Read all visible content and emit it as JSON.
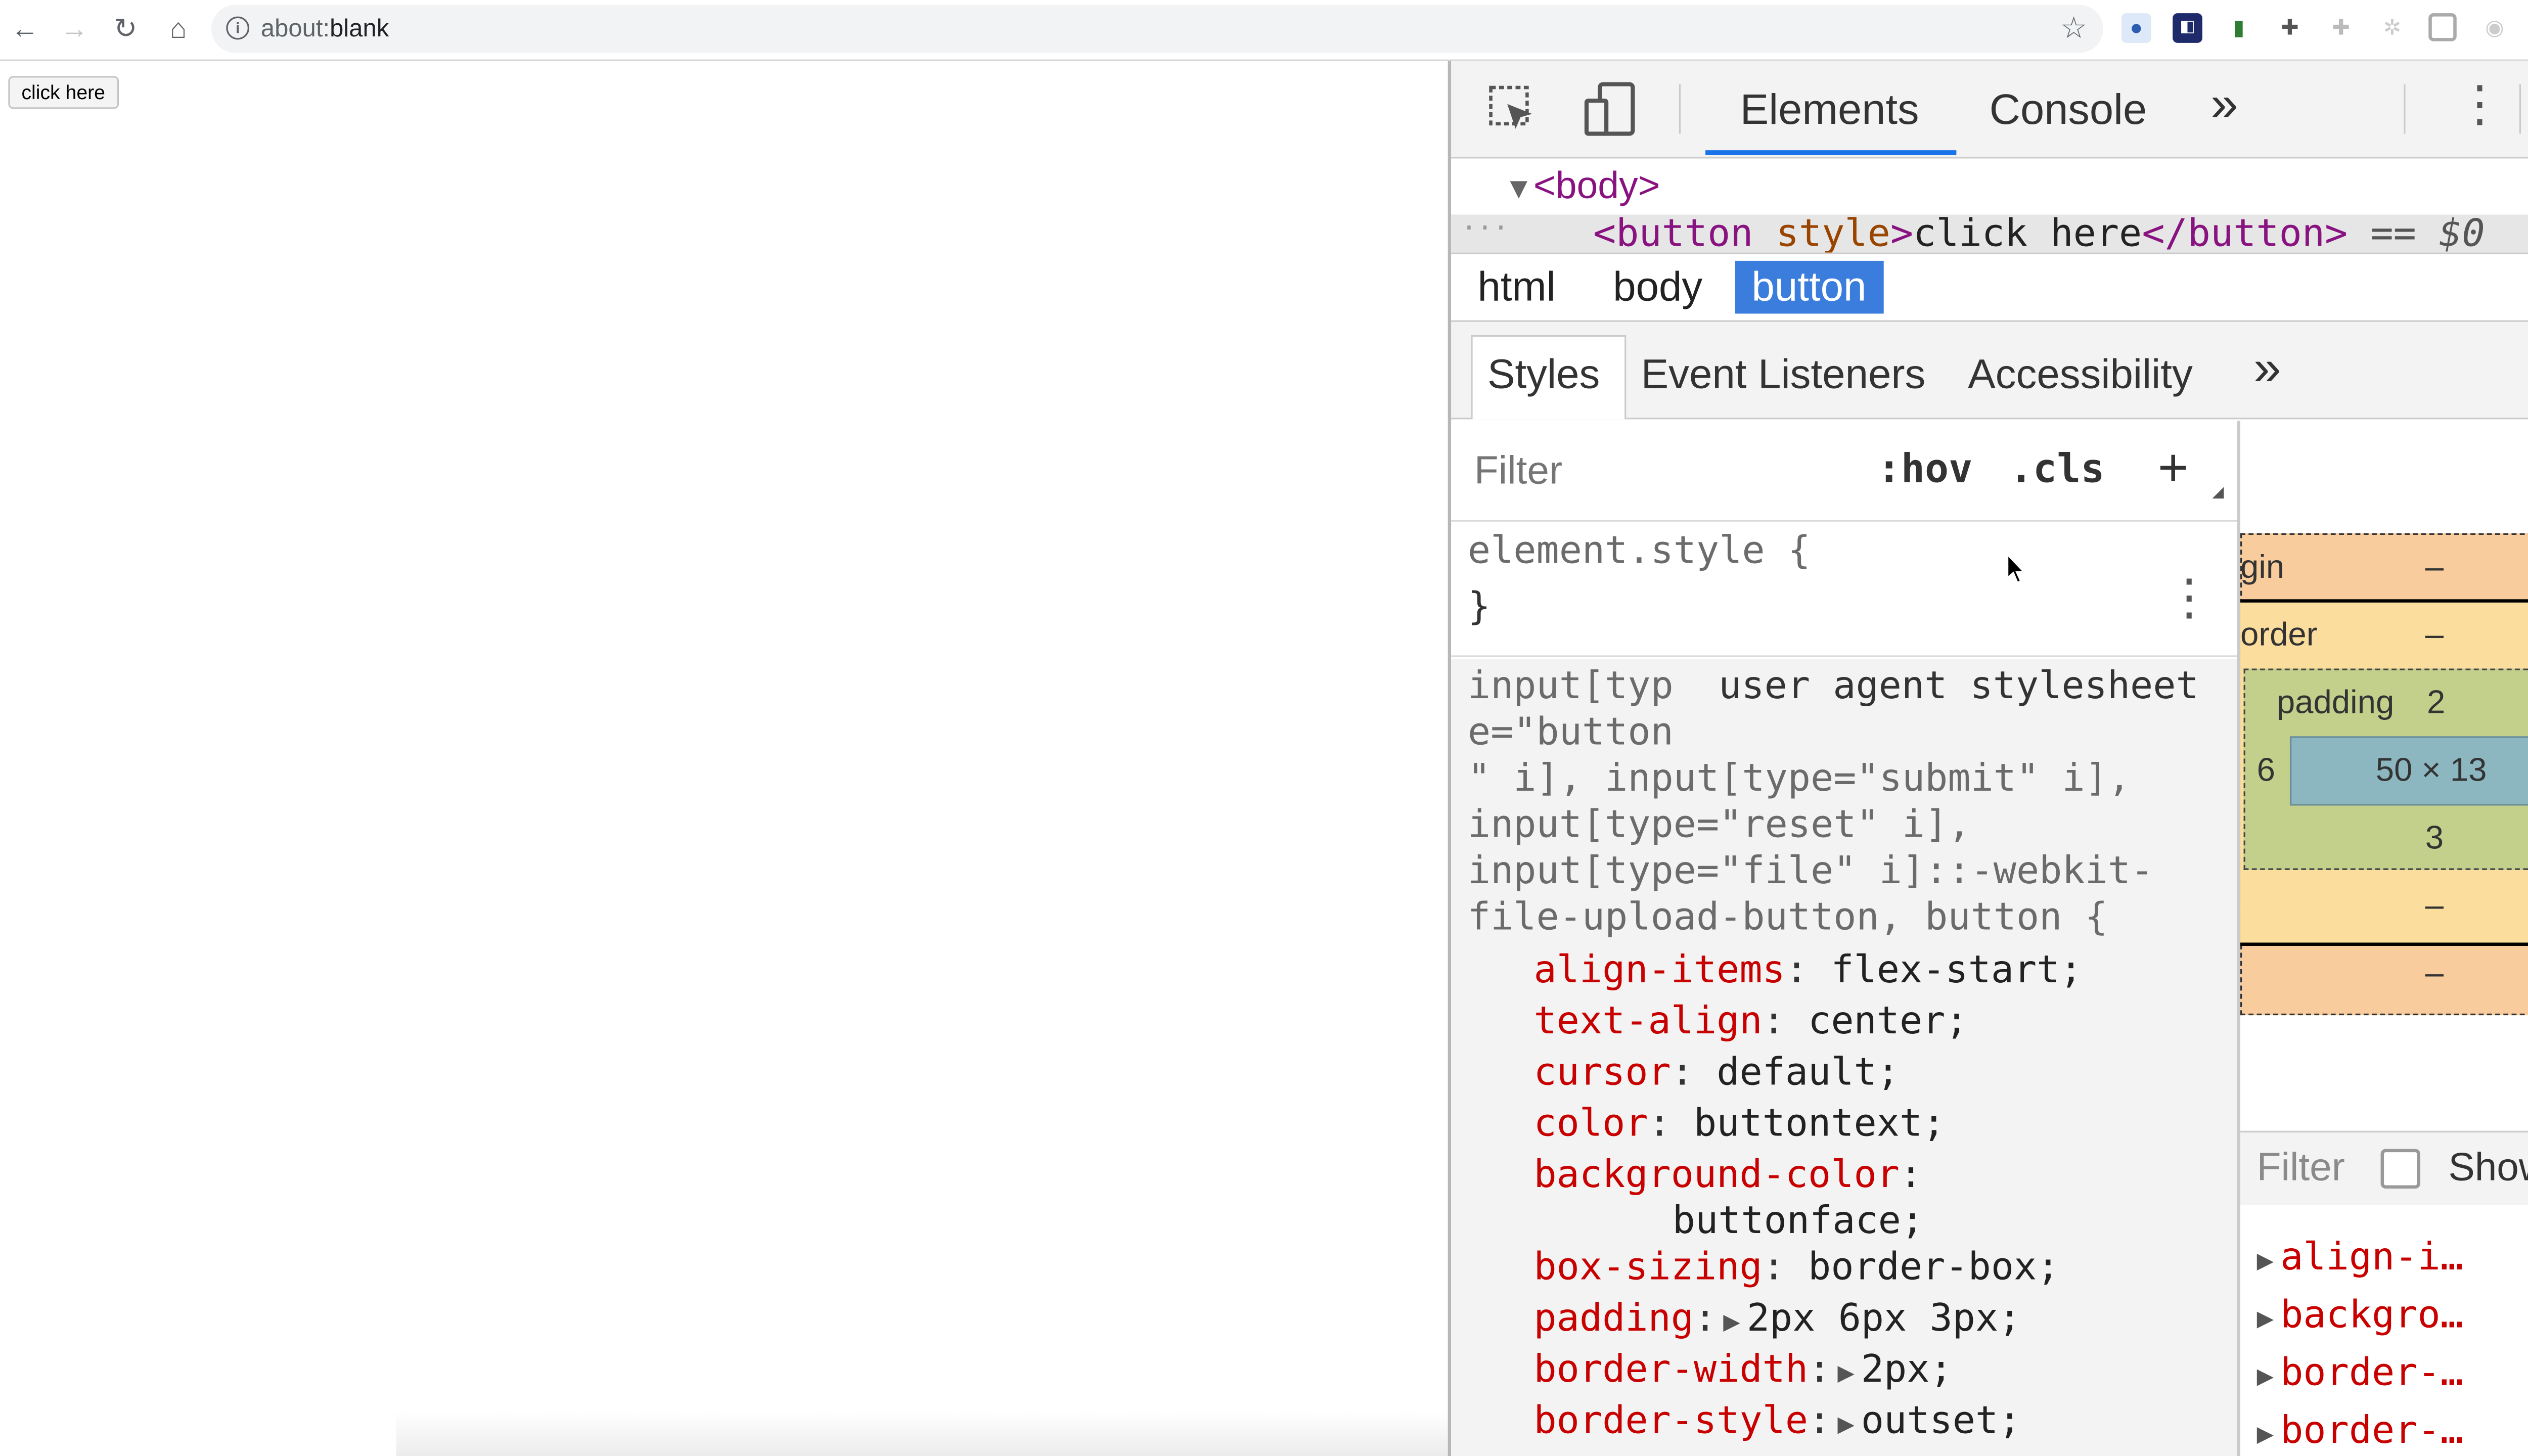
{
  "browser": {
    "url_dim": "about:",
    "url_main": "blank"
  },
  "page": {
    "button_label": "click here"
  },
  "devtools": {
    "tabs": [
      "Elements",
      "Console",
      "»"
    ],
    "dom": {
      "body_open": "<body>",
      "button_open": "<button",
      "button_attr": " style",
      "button_open_end": ">",
      "button_text": "click here",
      "button_close": "</button>",
      "selected_suffix": " == $0",
      "ellipsis": "..."
    },
    "breadcrumbs": [
      "html",
      "body",
      "button"
    ],
    "subtabs": [
      "Styles",
      "Event Listeners",
      "Accessibility",
      "»"
    ],
    "filter": {
      "placeholder": "Filter",
      "hov": ":hov",
      "cls": ".cls",
      "add": "+"
    },
    "element_style": {
      "selector": "element.style {",
      "close": "}"
    },
    "ua_rule": {
      "source": "user agent stylesheet",
      "selector_lines": [
        "input[typ",
        "e=\"button",
        "\" i], input[type=\"submit\" i],",
        "input[type=\"reset\" i],",
        "input[type=\"file\" i]::-webkit-",
        "file-upload-button, button {"
      ],
      "declarations": [
        {
          "prop": "align-items",
          "value": "flex-start;"
        },
        {
          "prop": "text-align",
          "value": "center;"
        },
        {
          "prop": "cursor",
          "value": "default;"
        },
        {
          "prop": "color",
          "value": "buttontext;"
        },
        {
          "prop": "background-color",
          "value": ":"
        },
        {
          "prop": "",
          "value": "buttonface;"
        },
        {
          "prop": "box-sizing",
          "value": "border-box;"
        },
        {
          "prop": "padding",
          "value": "2px 6px 3px;"
        },
        {
          "prop": "border-width",
          "value": "2px;"
        },
        {
          "prop": "border-style",
          "value": "outset;"
        }
      ]
    },
    "box_model": {
      "margin_label": "gin",
      "margin_top": "–",
      "border_label": "order",
      "border_top": "–",
      "padding_label": "padding",
      "padding_top": "2",
      "padding_left": "6",
      "content_size": "50 × 13",
      "padding_bottom": "3",
      "border_bottom": "–",
      "margin_bottom": "–"
    },
    "computed": {
      "filter_placeholder": "Filter",
      "show_all": "Show a",
      "properties": [
        "align-i…",
        "backgro…",
        "border-…",
        "border-…"
      ]
    }
  },
  "colors": {
    "accent": "#1a73e8",
    "selected_crumb": "#3b7ddd",
    "css_property": "#c80000",
    "tag": "#881280",
    "margin_box": "#f9cc9d",
    "border_box": "#fbdd9d",
    "padding_box": "#c3d08b",
    "content_box": "#8cb6c0"
  }
}
